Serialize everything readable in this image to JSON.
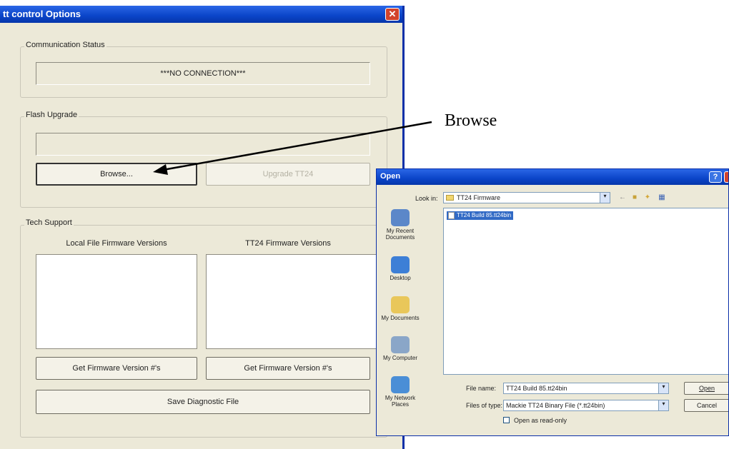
{
  "main_window": {
    "title": "tt control Options",
    "comm_status": {
      "label": "Communication Status",
      "value": "***NO CONNECTION***"
    },
    "flash_upgrade": {
      "label": "Flash Upgrade",
      "path_value": "",
      "browse_label": "Browse...",
      "upgrade_label": "Upgrade TT24"
    },
    "tech_support": {
      "label": "Tech Support",
      "local_header": "Local File Firmware Versions",
      "tt24_header": "TT24 Firmware Versions",
      "get_local_label": "Get Firmware Version #'s",
      "get_tt24_label": "Get Firmware Version #'s",
      "save_diag_label": "Save Diagnostic File"
    }
  },
  "annotation": {
    "text": "Browse"
  },
  "open_dialog": {
    "title": "Open",
    "look_in_label": "Look in:",
    "look_in_value": "TT24 Firmware",
    "places": [
      {
        "label": "My Recent Documents",
        "icon": "recent-documents-icon",
        "color": "#5b87c9"
      },
      {
        "label": "Desktop",
        "icon": "desktop-icon",
        "color": "#3d7fd6"
      },
      {
        "label": "My Documents",
        "icon": "my-documents-icon",
        "color": "#e9c75a"
      },
      {
        "label": "My Computer",
        "icon": "my-computer-icon",
        "color": "#8aa6c8"
      },
      {
        "label": "My Network Places",
        "icon": "network-places-icon",
        "color": "#4a8ed6"
      }
    ],
    "files": [
      "TT24 Build 85.tt24bin"
    ],
    "file_name_label": "File name:",
    "file_name_value": "TT24 Build 85.tt24bin",
    "file_type_label": "Files of type:",
    "file_type_value": "Mackie TT24 Binary File (*.tt24bin)",
    "read_only_label": "Open as read-only",
    "open_label": "Open",
    "cancel_label": "Cancel"
  }
}
